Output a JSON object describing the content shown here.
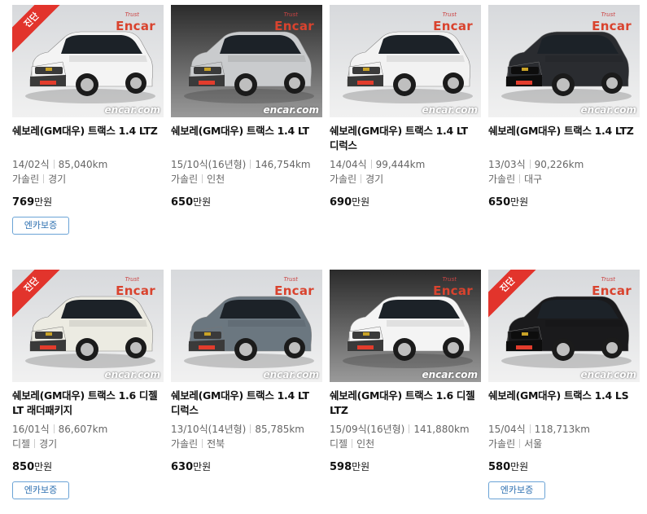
{
  "watermark": {
    "brand": "Encar",
    "brand_small": "Trust",
    "site": "encar.com"
  },
  "ribbon_label": "진단",
  "warranty_label": "엔카보증",
  "price_unit": "만원",
  "cars": [
    {
      "title": "쉐보레(GM대우) 트랙스 1.4 LTZ",
      "year": "14/02식",
      "mileage": "85,040km",
      "fuel": "가솔린",
      "region": "경기",
      "price": "769",
      "diagnosed": true,
      "warranty": true,
      "color": "#f4f4f4",
      "bg": "light"
    },
    {
      "title": "쉐보레(GM대우) 트랙스 1.4 LT",
      "year": "15/10식(16년형)",
      "mileage": "146,754km",
      "fuel": "가솔린",
      "region": "인천",
      "price": "650",
      "diagnosed": false,
      "warranty": false,
      "color": "#c9cbcd",
      "bg": "dark"
    },
    {
      "title": "쉐보레(GM대우) 트랙스 1.4 LT 디럭스",
      "year": "14/04식",
      "mileage": "99,444km",
      "fuel": "가솔린",
      "region": "경기",
      "price": "690",
      "diagnosed": false,
      "warranty": false,
      "color": "#f2f2f2",
      "bg": "light"
    },
    {
      "title": "쉐보레(GM대우) 트랙스 1.4 LTZ",
      "year": "13/03식",
      "mileage": "90,226km",
      "fuel": "가솔린",
      "region": "대구",
      "price": "650",
      "diagnosed": false,
      "warranty": false,
      "color": "#2a2c30",
      "bg": "light"
    },
    {
      "title": "쉐보레(GM대우) 트랙스 1.6 디젤 LT 래더패키지",
      "year": "16/01식",
      "mileage": "86,607km",
      "fuel": "디젤",
      "region": "경기",
      "price": "850",
      "diagnosed": true,
      "warranty": true,
      "color": "#ecebe2",
      "bg": "light"
    },
    {
      "title": "쉐보레(GM대우) 트랙스 1.4 LT 디럭스",
      "year": "13/10식(14년형)",
      "mileage": "85,785km",
      "fuel": "가솔린",
      "region": "전북",
      "price": "630",
      "diagnosed": false,
      "warranty": false,
      "color": "#6b7780",
      "bg": "light"
    },
    {
      "title": "쉐보레(GM대우) 트랙스 1.6 디젤 LTZ",
      "year": "15/09식(16년형)",
      "mileage": "141,880km",
      "fuel": "디젤",
      "region": "인천",
      "price": "598",
      "diagnosed": false,
      "warranty": false,
      "color": "#f4f4f4",
      "bg": "dark"
    },
    {
      "title": "쉐보레(GM대우) 트랙스 1.4 LS",
      "year": "15/04식",
      "mileage": "118,713km",
      "fuel": "가솔린",
      "region": "서울",
      "price": "580",
      "diagnosed": true,
      "warranty": true,
      "color": "#1a1a1c",
      "bg": "light"
    }
  ]
}
